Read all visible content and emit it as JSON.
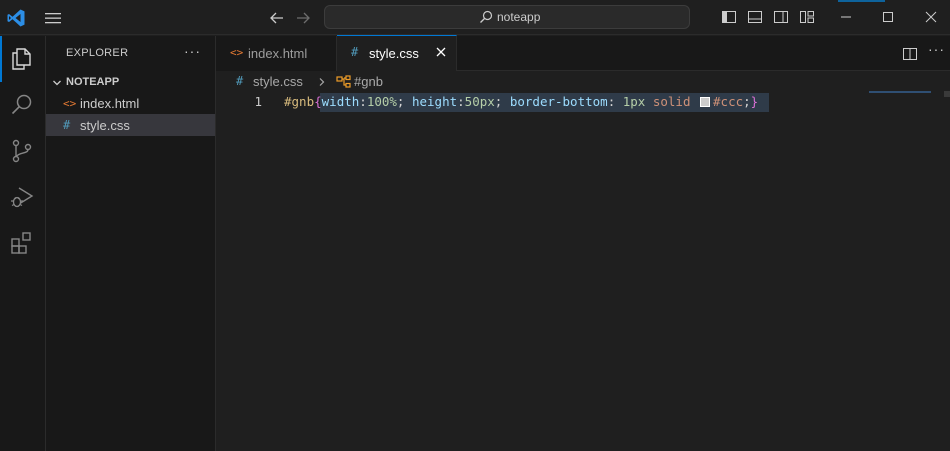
{
  "titlebar": {
    "search_text": "noteapp",
    "accent_color": "#0078d4"
  },
  "activity": {
    "items": [
      "explorer-icon",
      "search-icon",
      "source-control-icon",
      "run-debug-icon",
      "extensions-icon"
    ]
  },
  "sidebar": {
    "title": "EXPLORER",
    "more": "···",
    "folder": "NOTEAPP",
    "files": [
      {
        "icon": "<>",
        "label": "index.html",
        "icon_color": "#e37933"
      },
      {
        "icon": "#",
        "label": "style.css",
        "icon_color": "#519aba"
      }
    ]
  },
  "tabs": [
    {
      "icon": "<>",
      "label": "index.html",
      "active": false
    },
    {
      "icon": "#",
      "label": "style.css",
      "active": true
    }
  ],
  "editor_more": "···",
  "breadcrumb": {
    "icon": "#",
    "file": "style.css",
    "symbol": "#gnb"
  },
  "code": {
    "line_number": "1",
    "selector": "#gnb",
    "open_brace": "{",
    "close_brace": "}",
    "tokens": {
      "p1": "width",
      "v1": "100%",
      "p2": "height",
      "v2": "50px",
      "p3": "border-bottom",
      "v3a": "1px",
      "v3b": "solid",
      "v3c": "#ccc"
    },
    "swatch_color": "#cccccc"
  }
}
